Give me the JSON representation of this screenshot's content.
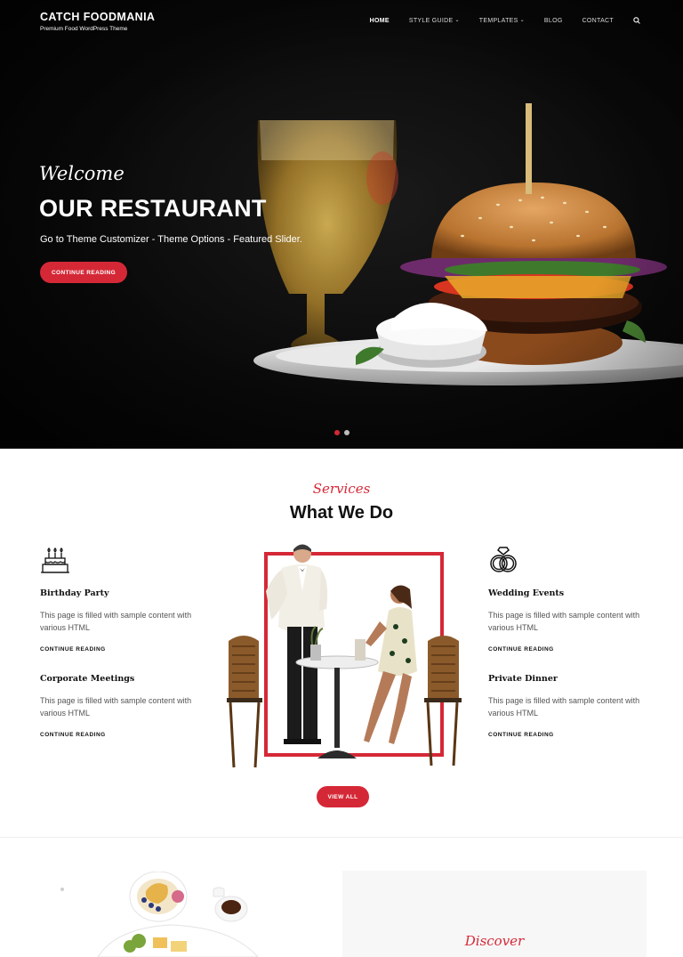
{
  "header": {
    "site_title": "CATCH FOODMANIA",
    "tagline": "Premium Food WordPress Theme",
    "nav": [
      {
        "label": "HOME",
        "active": true,
        "has_dropdown": false
      },
      {
        "label": "STYLE GUIDE",
        "active": false,
        "has_dropdown": true
      },
      {
        "label": "TEMPLATES",
        "active": false,
        "has_dropdown": true
      },
      {
        "label": "BLOG",
        "active": false,
        "has_dropdown": false
      },
      {
        "label": "CONTACT",
        "active": false,
        "has_dropdown": false
      }
    ],
    "search_icon": "search-icon"
  },
  "hero": {
    "welcome": "Welcome",
    "title": "OUR RESTAURANT",
    "description": "Go to Theme Customizer - Theme Options - Featured Slider.",
    "button_label": "CONTINUE READING",
    "slides_count": 2,
    "active_slide": 1
  },
  "services": {
    "subtitle": "Services",
    "title": "What We Do",
    "items": [
      {
        "icon": "birthday-cake-icon",
        "name": "Birthday Party",
        "text": "This page is filled with sample content with various HTML",
        "more": "CONTINUE READING"
      },
      {
        "icon": "corporate-icon",
        "name": "Corporate Meetings",
        "text": "This page is filled with sample content with various HTML",
        "more": "CONTINUE READING"
      },
      {
        "icon": "wedding-rings-icon",
        "name": "Wedding Events",
        "text": "This page is filled with sample content with various HTML",
        "more": "CONTINUE READING"
      },
      {
        "icon": "dinner-icon",
        "name": "Private Dinner",
        "text": "This page is filled with sample content with various HTML",
        "more": "CONTINUE READING"
      }
    ],
    "view_all_label": "VIEW ALL"
  },
  "discover": {
    "subtitle": "Discover"
  },
  "colors": {
    "accent": "#d52836",
    "hero_bg": "#0a0a0a",
    "text": "#111111",
    "muted_text": "#555555"
  }
}
